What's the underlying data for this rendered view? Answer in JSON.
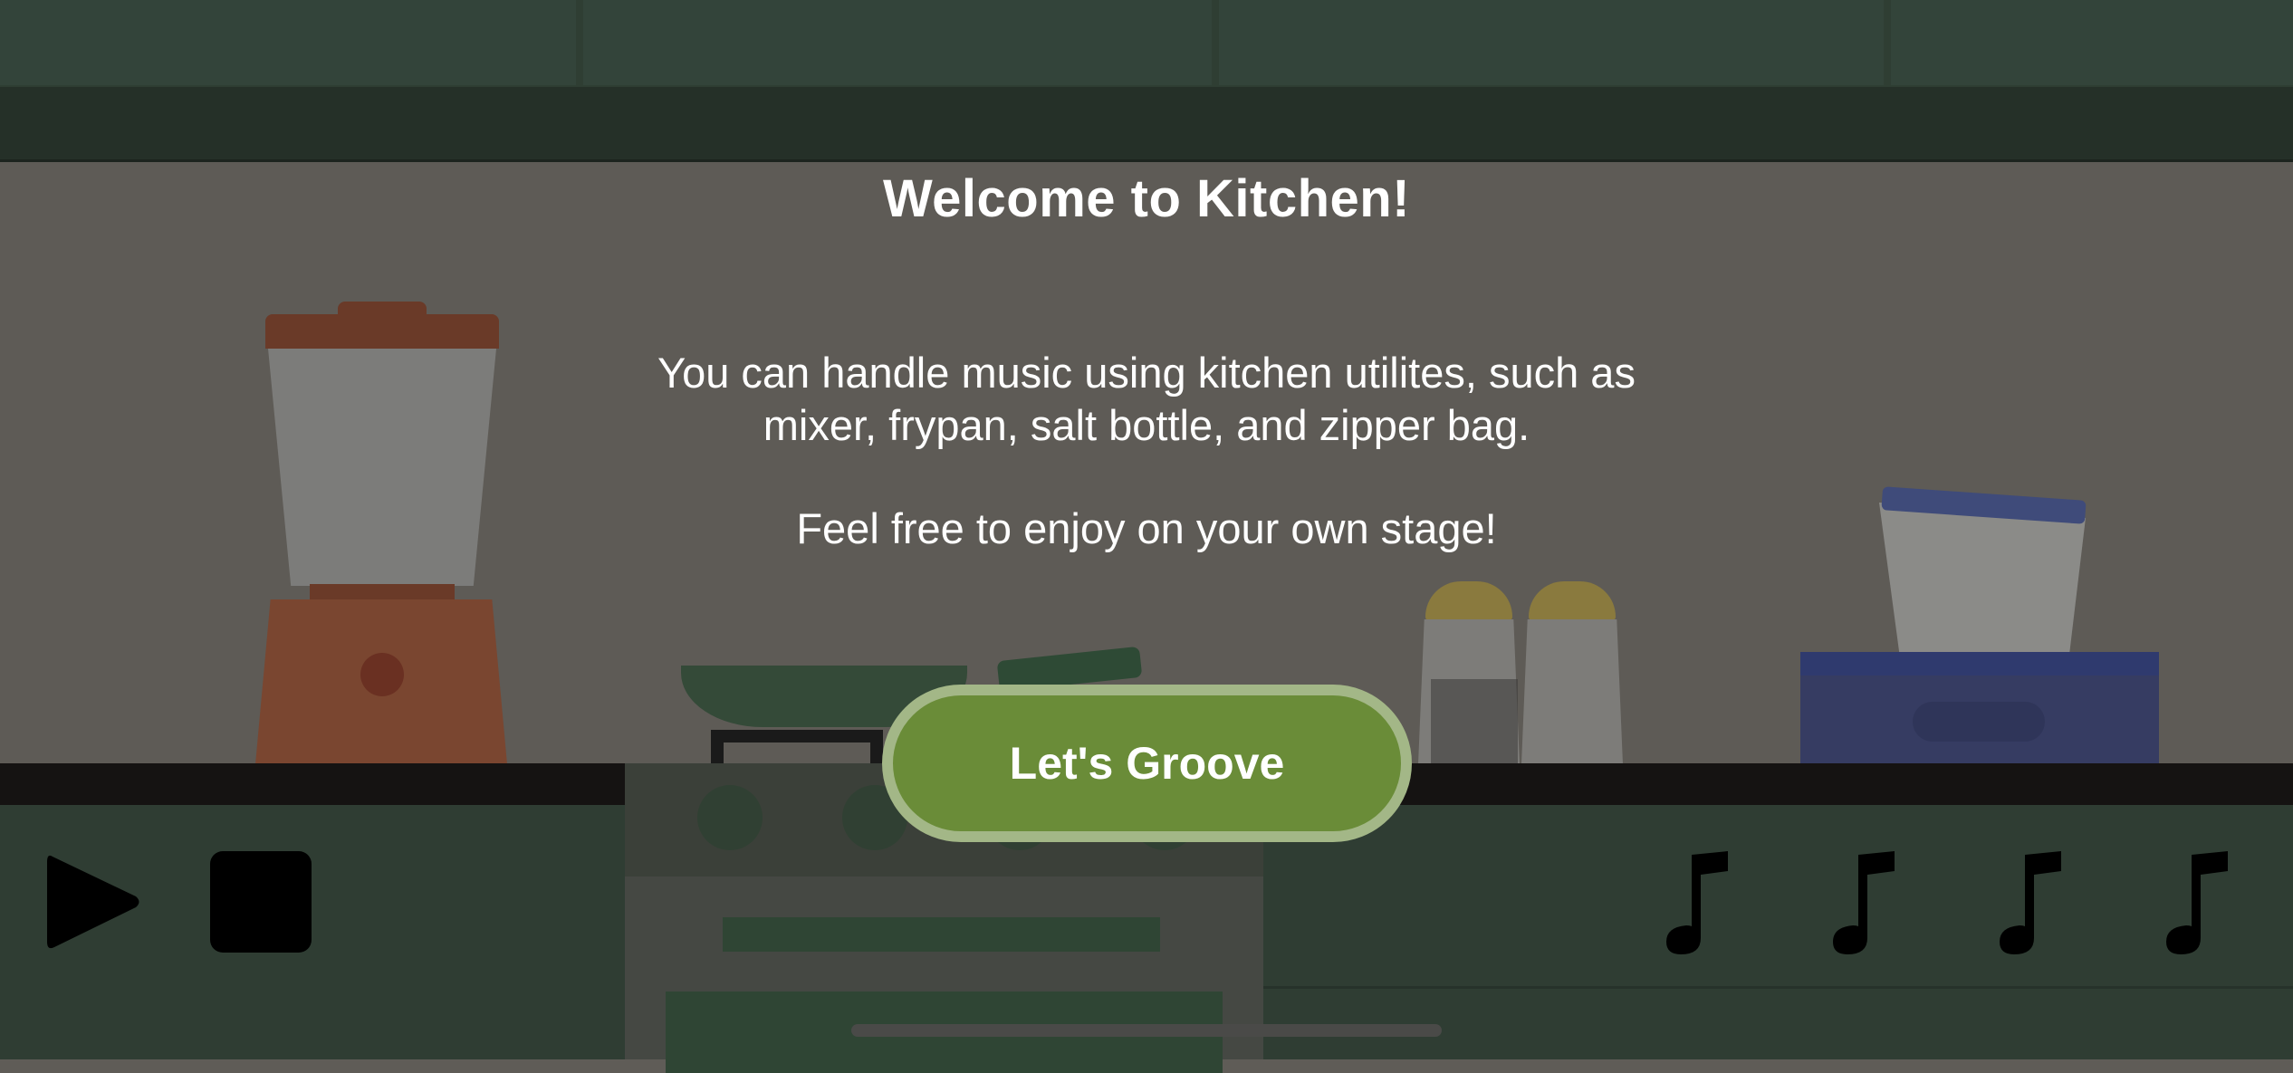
{
  "dialog": {
    "title": "Welcome to Kitchen!",
    "description": "You can handle music using kitchen utilites, such as mixer, frypan, salt bottle, and zipper bag.",
    "subtitle": "Feel free to enjoy on your own stage!",
    "start_label": "Let's Groove"
  },
  "controls": {
    "play_icon": "play-icon",
    "stop_icon": "stop-icon",
    "note_icon": "music-note-icon",
    "note_count": 4
  },
  "colors": {
    "button_fill": "#6a8c38",
    "button_border": "#a3b787",
    "cabinet": "#2f3d33",
    "wall": "#5e5b56"
  }
}
